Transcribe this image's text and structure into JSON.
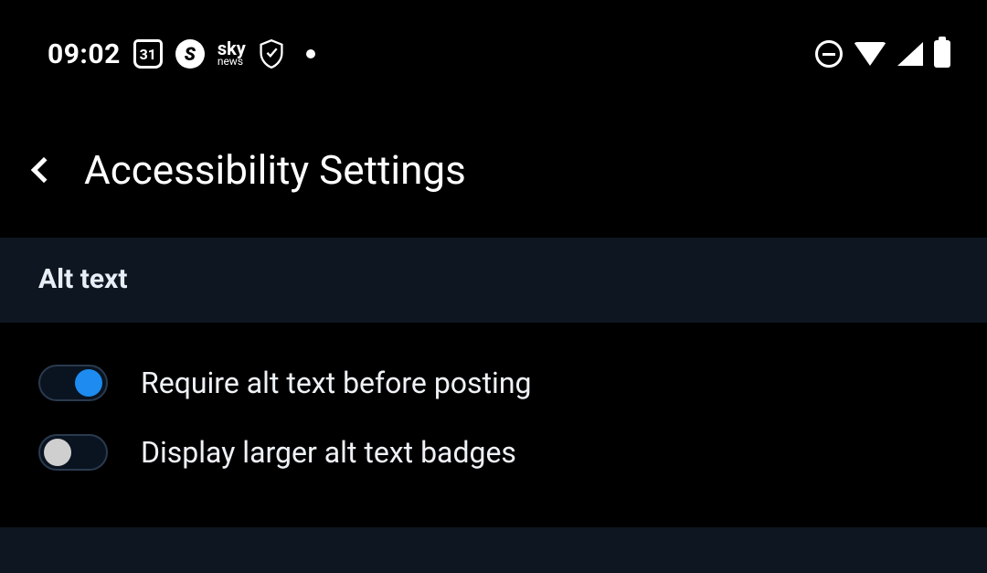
{
  "statusBar": {
    "time": "09:02",
    "calendarDay": "31",
    "skyTop": "sky",
    "skyBottom": "news"
  },
  "header": {
    "title": "Accessibility Settings"
  },
  "section": {
    "title": "Alt text"
  },
  "settings": {
    "requireAlt": {
      "label": "Require alt text before posting",
      "on": true
    },
    "largerBadges": {
      "label": "Display larger alt text badges",
      "on": false
    }
  }
}
